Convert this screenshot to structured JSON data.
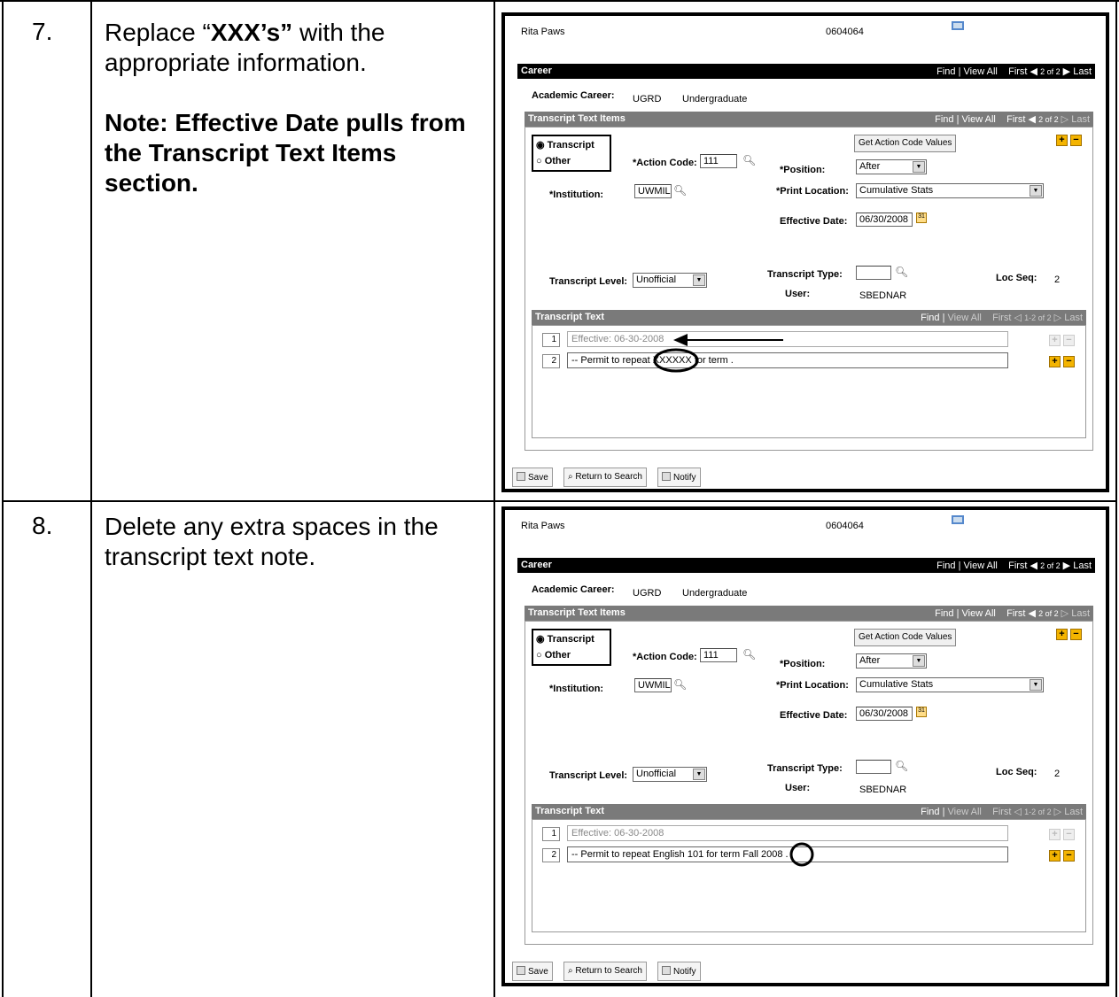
{
  "steps": [
    {
      "number": "7.",
      "text_parts": [
        "Replace “",
        "XXX’s”",
        " with the appropriate information."
      ],
      "note": "Note:  Effective Date pulls from the Transcript Text Items section.",
      "screenshot": {
        "student_name": "Rita Paws",
        "student_id": "0604064",
        "career_bar": "Career",
        "career_nav": {
          "find": "Find",
          "view_all": "View All",
          "first": "First",
          "count": "2 of 2",
          "last": "Last"
        },
        "academic_career_label": "Academic Career:",
        "academic_career_code": "UGRD",
        "academic_career_desc": "Undergraduate",
        "items_bar": "Transcript Text Items",
        "items_nav": {
          "find": "Find",
          "view_all": "View All",
          "first": "First",
          "count": "2 of 2",
          "last": "Last"
        },
        "radio_transcript": "Transcript",
        "radio_other": "Other",
        "action_code_label": "*Action Code:",
        "action_code_value": "111",
        "get_action_button": "Get Action Code Values",
        "position_label": "*Position:",
        "position_value": "After",
        "institution_label": "*Institution:",
        "institution_value": "UWMIL",
        "print_location_label": "*Print Location:",
        "print_location_value": "Cumulative Stats",
        "effective_date_label": "Effective Date:",
        "effective_date_value": "06/30/2008",
        "transcript_type_label": "Transcript Type:",
        "transcript_level_label": "Transcript Level:",
        "transcript_level_value": "Unofficial",
        "loc_seq_label": "Loc Seq:",
        "loc_seq_value": "2",
        "user_label": "User:",
        "user_value": "SBEDNAR",
        "text_bar": "Transcript Text",
        "text_nav": {
          "find": "Find",
          "view_all": "View All",
          "first": "First",
          "count": "1-2 of 2",
          "last": "Last"
        },
        "rows": [
          {
            "num": "1",
            "text": "Effective: 06-30-2008"
          },
          {
            "num": "2",
            "text": "-- Permit to repeat XXXXXX for term          ."
          }
        ],
        "save": "Save",
        "return": "Return to Search",
        "notify": "Notify"
      }
    },
    {
      "number": "8.",
      "text": "Delete any extra spaces in the transcript text note.",
      "screenshot": {
        "student_name": "Rita Paws",
        "student_id": "0604064",
        "career_bar": "Career",
        "career_nav": {
          "find": "Find",
          "view_all": "View All",
          "first": "First",
          "count": "2 of 2",
          "last": "Last"
        },
        "academic_career_label": "Academic Career:",
        "academic_career_code": "UGRD",
        "academic_career_desc": "Undergraduate",
        "items_bar": "Transcript Text Items",
        "items_nav": {
          "find": "Find",
          "view_all": "View All",
          "first": "First",
          "count": "2 of 2",
          "last": "Last"
        },
        "radio_transcript": "Transcript",
        "radio_other": "Other",
        "action_code_label": "*Action Code:",
        "action_code_value": "111",
        "get_action_button": "Get Action Code Values",
        "position_label": "*Position:",
        "position_value": "After",
        "institution_label": "*Institution:",
        "institution_value": "UWMIL",
        "print_location_label": "*Print Location:",
        "print_location_value": "Cumulative Stats",
        "effective_date_label": "Effective Date:",
        "effective_date_value": "06/30/2008",
        "transcript_type_label": "Transcript Type:",
        "transcript_level_label": "Transcript Level:",
        "transcript_level_value": "Unofficial",
        "loc_seq_label": "Loc Seq:",
        "loc_seq_value": "2",
        "user_label": "User:",
        "user_value": "SBEDNAR",
        "text_bar": "Transcript Text",
        "text_nav": {
          "find": "Find",
          "view_all": "View All",
          "first": "First",
          "count": "1-2 of 2",
          "last": "Last"
        },
        "rows": [
          {
            "num": "1",
            "text": "Effective: 06-30-2008"
          },
          {
            "num": "2",
            "text": "-- Permit to repeat English 101 for term  Fall 2008     ."
          }
        ],
        "save": "Save",
        "return": "Return to Search",
        "notify": "Notify"
      }
    }
  ],
  "colors": {
    "bar_dark": "#000000",
    "bar_gray": "#7a7a7a",
    "accent_yellow": "#f4b400"
  }
}
